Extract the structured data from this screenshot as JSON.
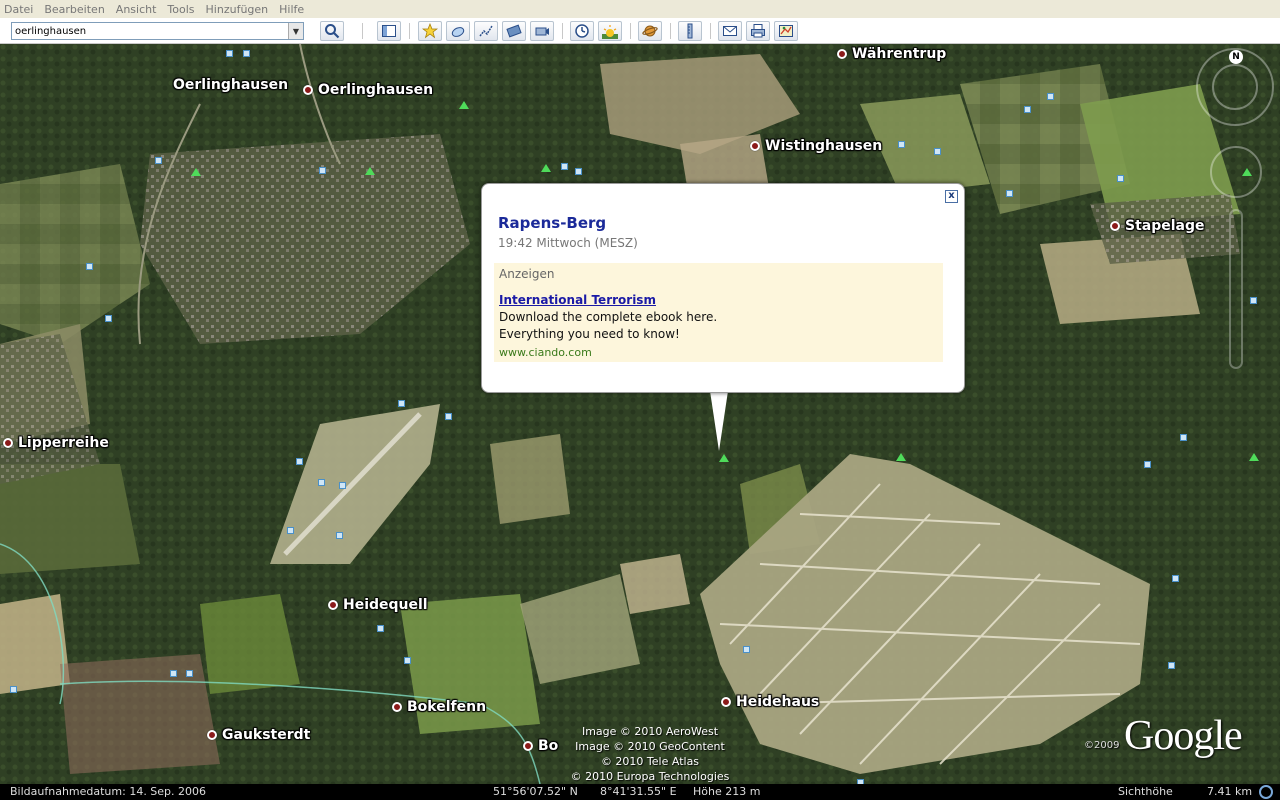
{
  "menu": {
    "items": [
      "Datei",
      "Bearbeiten",
      "Ansicht",
      "Tools",
      "Hinzufügen",
      "Hilfe"
    ]
  },
  "toolbar": {
    "search_value": "oerlinghausen"
  },
  "places": [
    {
      "name": "Oerlinghausen"
    },
    {
      "name": "Oerlinghausen"
    },
    {
      "name": "Währentrup"
    },
    {
      "name": "Wistinghausen"
    },
    {
      "name": "Stapelage"
    },
    {
      "name": "Lipperreihe"
    },
    {
      "name": "Heidequell"
    },
    {
      "name": "Heidehaus"
    },
    {
      "name": "Bokelfenn"
    },
    {
      "name": "Gauksterdt"
    },
    {
      "name": "Bo"
    }
  ],
  "balloon": {
    "title": "Rapens-Berg",
    "subtitle": "19:42 Mittwoch (MESZ)",
    "ad_label": "Anzeigen",
    "ad_title": "International Terrorism",
    "ad_line1": "Download the complete ebook here.",
    "ad_line2": "Everything you need to know!",
    "ad_url": "www.ciando.com",
    "close_label": "x"
  },
  "credits": {
    "line1": "Image © 2010 AeroWest",
    "line2": "Image © 2010 GeoContent",
    "line3": "© 2010 Tele Atlas",
    "line4": "© 2010 Europa Technologies",
    "copyright": "©2009",
    "logo": "Google"
  },
  "nav": {
    "north": "N"
  },
  "statusbar": {
    "date": "Bildaufnahmedatum: 14. Sep. 2006",
    "lat": "51°56'07.52\"  N",
    "lon": "8°41'31.55\"  E",
    "elevation": "Höhe  213 m",
    "eye_label": "Sichthöhe",
    "eye_value": "7.41 km"
  },
  "colors": {
    "place_marker": "#8b1a1a",
    "balloon_title": "#1b2a99",
    "ad_background": "#fdf6dc",
    "ad_url": "#3a7a1a"
  }
}
